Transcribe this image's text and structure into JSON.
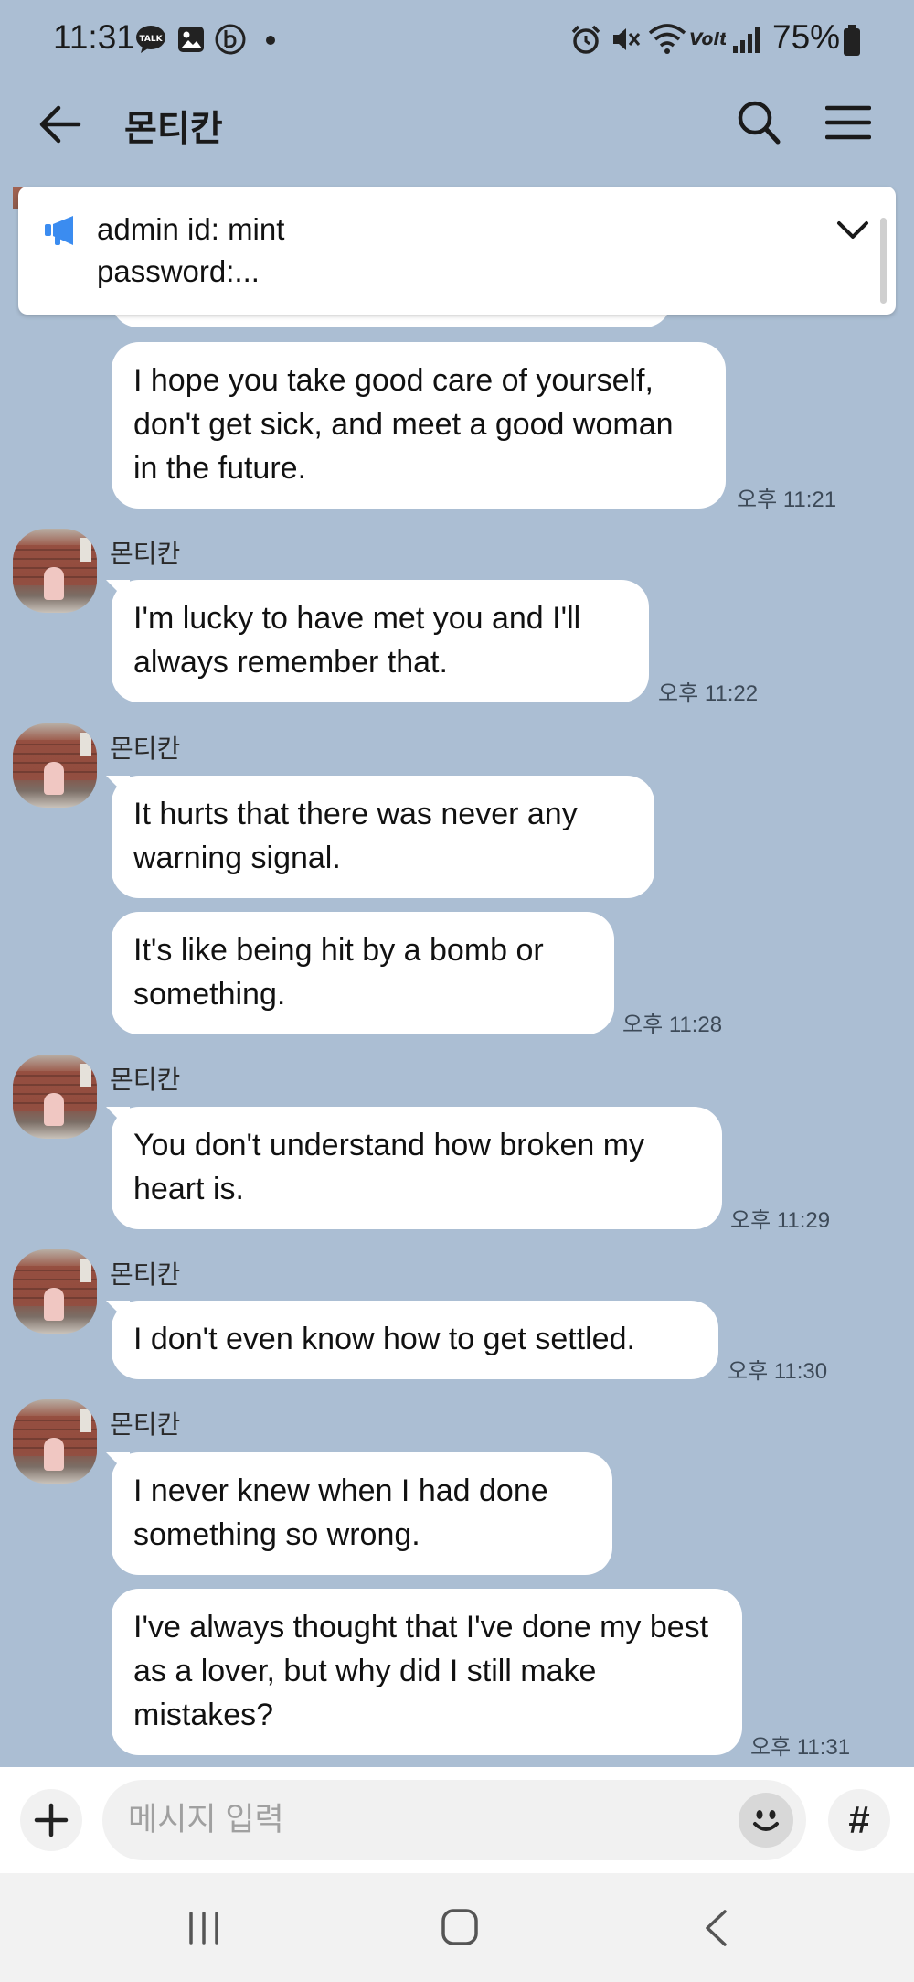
{
  "status_bar": {
    "time": "11:31",
    "battery": "75%",
    "left_icons": [
      "talk-icon",
      "gallery-icon",
      "b-app-icon",
      "dot-icon"
    ],
    "right_icons": [
      "alarm-icon",
      "mute-icon",
      "wifi-icon",
      "volte-icon",
      "signal-icon",
      "battery-icon"
    ]
  },
  "header": {
    "title": "몬티칸"
  },
  "notice": {
    "line1": "admin id: mint",
    "line2": "password:..."
  },
  "messages": [
    {
      "text": "I hope you take good care of yourself, don't get sick, and meet a good woman in the future.",
      "time": "오후 11:21"
    },
    {
      "sender": "몬티칸",
      "text": "I'm lucky to have met you and I'll always remember that.",
      "time": "오후 11:22"
    },
    {
      "sender": "몬티칸",
      "text": "It hurts that there was never any warning signal."
    },
    {
      "text": "It's like being hit by a bomb or something.",
      "time": "오후 11:28"
    },
    {
      "sender": "몬티칸",
      "text": "You don't understand how broken my heart is.",
      "time": "오후 11:29"
    },
    {
      "sender": "몬티칸",
      "text": "I don't even know how to get settled.",
      "time": "오후 11:30"
    },
    {
      "sender": "몬티칸",
      "text": "I never knew when I had done something so wrong."
    },
    {
      "text": "I've always thought that I've done my best as a lover, but why did I still make mistakes?",
      "time": "오후 11:31"
    }
  ],
  "input": {
    "placeholder": "메시지 입력",
    "value": ""
  },
  "colors": {
    "chat_background": "#abbed3",
    "notice_icon": "#3b8cf0",
    "bubble": "#ffffff"
  }
}
